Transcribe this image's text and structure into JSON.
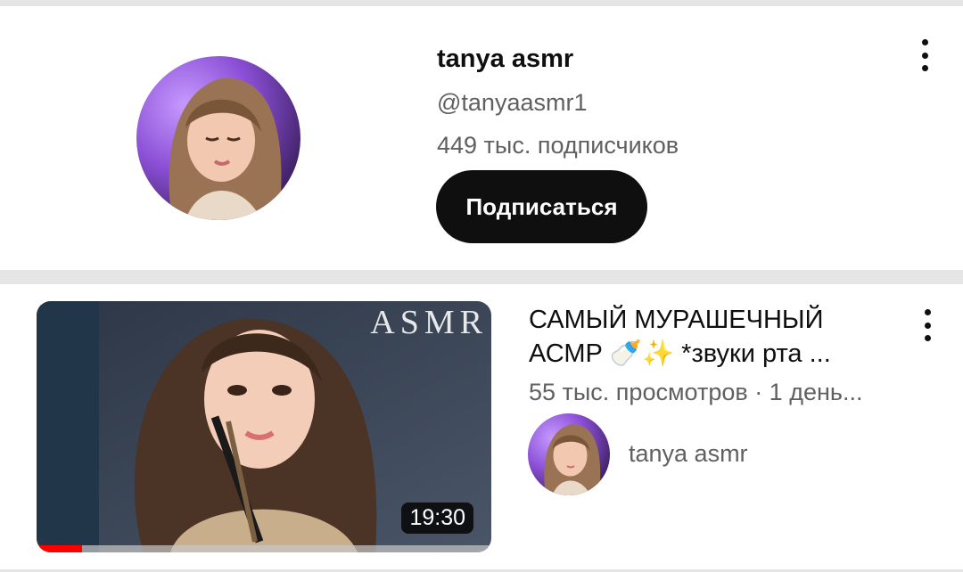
{
  "channel": {
    "name": "tanya asmr",
    "handle": "@tanyaasmr1",
    "subscribers": "449 тыс. подписчиков",
    "subscribe_label": "Подписаться",
    "more_icon": "more-vert-icon"
  },
  "video": {
    "thumbnail_text": "ASMR",
    "duration": "19:30",
    "watch_progress": 0.1,
    "title_line1": "САМЫЙ МУРАШЕЧНЫЙ",
    "title_line2": "АСМР 🍼✨ *звуки рта ...",
    "meta": "55 тыс. просмотров · 1 день...",
    "channel_name": "tanya asmr",
    "more_icon": "more-vert-icon"
  },
  "colors": {
    "subscribe_bg": "#0f0f0f",
    "progress": "#ff0000",
    "secondary_text": "#606060",
    "divider": "#e5e5e5"
  }
}
